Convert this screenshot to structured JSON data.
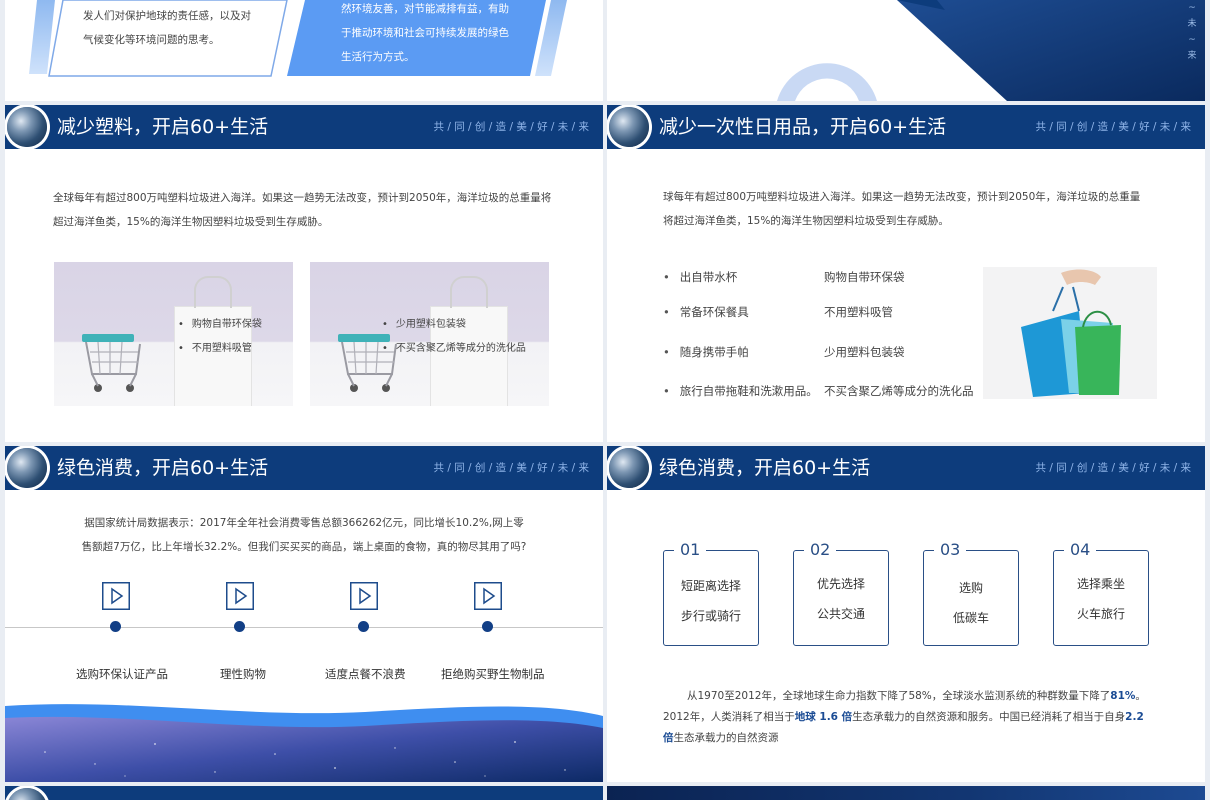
{
  "motto": "共 / 同 / 创 / 造 / 美 / 好 / 未 / 来",
  "top_left": {
    "para_a": [
      "发人们对保护地球的责任感，以及对",
      "气候变化等环境问题的思考。"
    ],
    "para_b": [
      "然环境友善，对节能减排有益，有助",
      "于推动环境和社会可持续发展的绿色",
      "生活行为方式。"
    ]
  },
  "top_right": {
    "vertical": [
      "~",
      "未",
      "~",
      "来"
    ]
  },
  "slide1": {
    "title": "减少塑料，开启60+生活",
    "para": [
      "全球每年有超过800万吨塑料垃圾进入海洋。如果这一趋势无法改变，预计到2050年，海洋垃圾的总重量将",
      "超过海洋鱼类，15%的海洋生物因塑料垃圾受到生存威胁。"
    ],
    "photo1": [
      "购物自带环保袋",
      "不用塑料吸管"
    ],
    "photo2": [
      "少用塑料包装袋",
      "不买含聚乙烯等成分的洗化品"
    ]
  },
  "slide2": {
    "title": "减少一次性日用品，开启60+生活",
    "para": [
      "球每年有超过800万吨塑料垃圾进入海洋。如果这一趋势无法改变，预计到2050年，海洋垃圾的总重量",
      "将超过海洋鱼类，15%的海洋生物因塑料垃圾受到生存威胁。"
    ],
    "col1": [
      "出自带水杯",
      "常备环保餐具",
      "随身携带手帕",
      "旅行自带拖鞋和洗漱用品。"
    ],
    "col2": [
      "购物自带环保袋",
      "不用塑料吸管",
      "少用塑料包装袋",
      "不买含聚乙烯等成分的洗化品"
    ]
  },
  "slide3": {
    "title": "绿色消费，开启60+生活",
    "para": [
      "据国家统计局数据表示：2017年全年社会消费零售总额366262亿元，同比增长10.2%,网上零",
      "售额超7万亿，比上年增长32.2%。但我们买买买的商品，端上桌面的食物，真的物尽其用了吗?"
    ],
    "items": [
      "选购环保认证产品",
      "理性购物",
      "适度点餐不浪费",
      "拒绝购买野生物制品"
    ]
  },
  "slide4": {
    "title": "绿色消费，开启60+生活",
    "boxes": [
      {
        "num": "01",
        "lines": [
          "短距离选择",
          "步行或骑行"
        ]
      },
      {
        "num": "02",
        "lines": [
          "优先选择",
          "公共交通"
        ]
      },
      {
        "num": "03",
        "lines": [
          "选购",
          "低碳车"
        ]
      },
      {
        "num": "04",
        "lines": [
          "选择乘坐",
          "火车旅行"
        ]
      }
    ],
    "p1": "从1970至2012年，全球地球生命力指数下降了58%，全球淡水监测系统的种群数量下降了",
    "p1_em": "81%",
    "p1_end": "。",
    "p2": "2012年，人类消耗了相当于",
    "p2_em": "地球 1.6 倍",
    "p2_end": "生态承载力的自然资源和服务。中国已经消耗了相当于自身",
    "p2_em2": "2.2",
    "p3_em": "倍",
    "p3_end": "生态承载力的自然资源"
  }
}
